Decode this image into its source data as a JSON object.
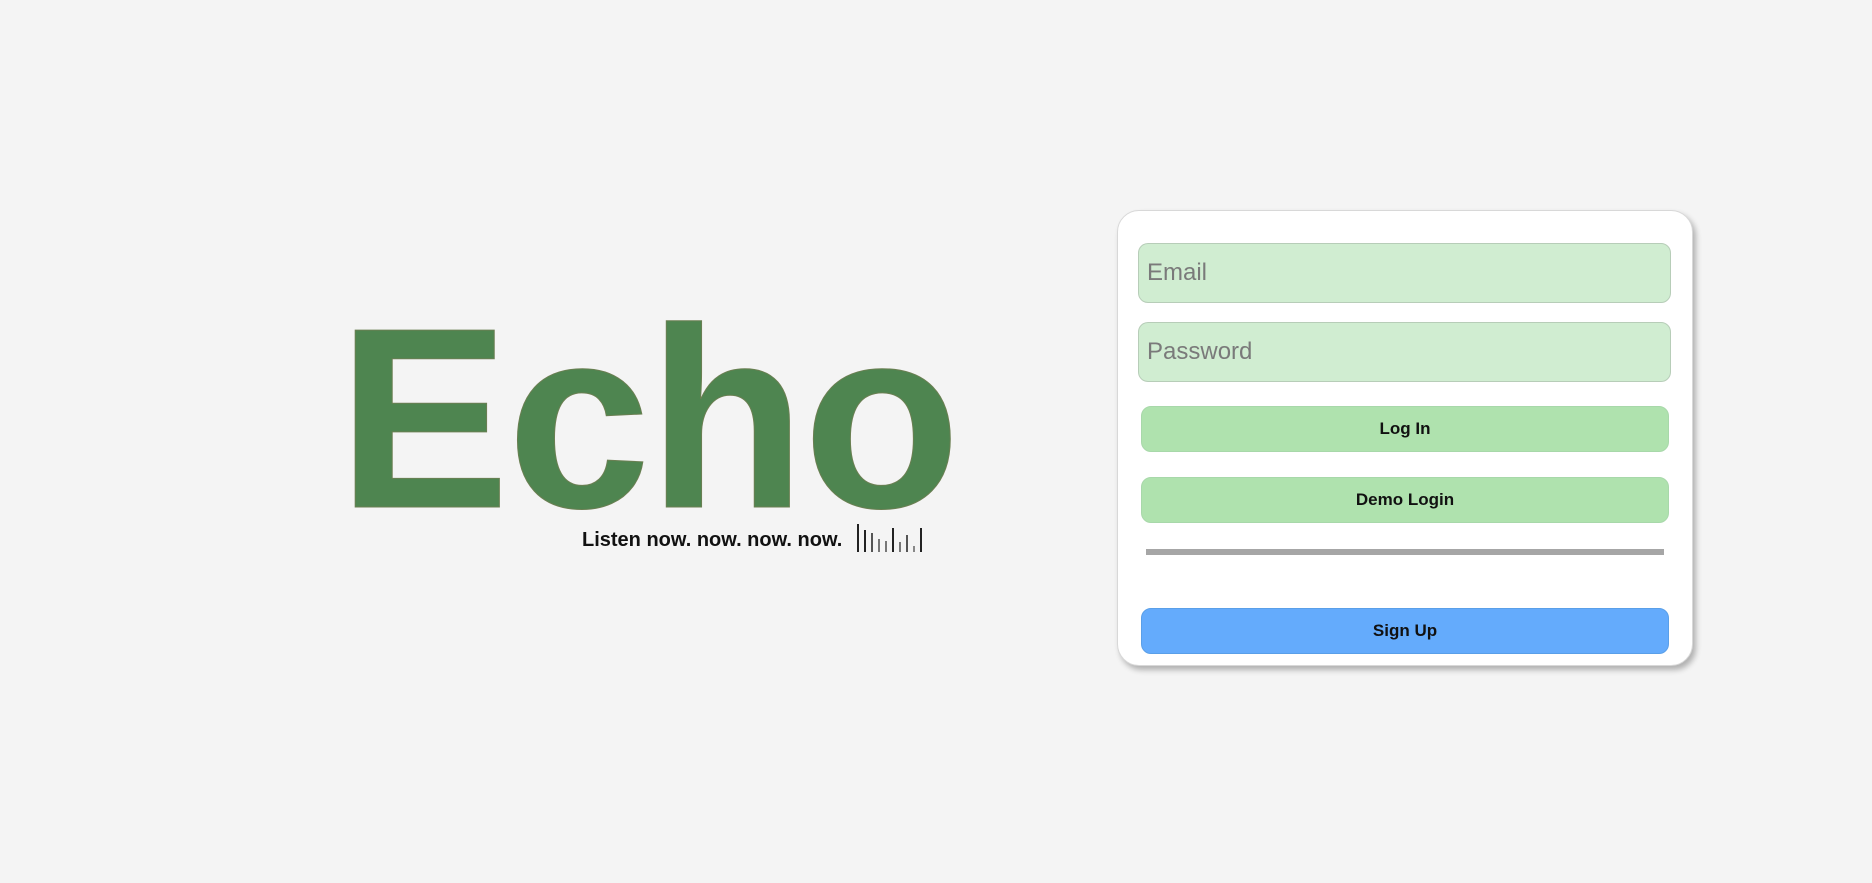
{
  "brand": {
    "logo_text": "Echo",
    "tagline": "Listen now. now. now. now.",
    "logo_color": "#4e8550",
    "wave_icon": "soundwave-icon"
  },
  "login": {
    "email_placeholder": "Email",
    "password_placeholder": "Password",
    "login_label": "Log In",
    "demo_label": "Demo Login",
    "signup_label": "Sign Up",
    "field_color": "#d0edd1",
    "button_color": "#afe2ae",
    "signup_color": "#64abfc"
  }
}
